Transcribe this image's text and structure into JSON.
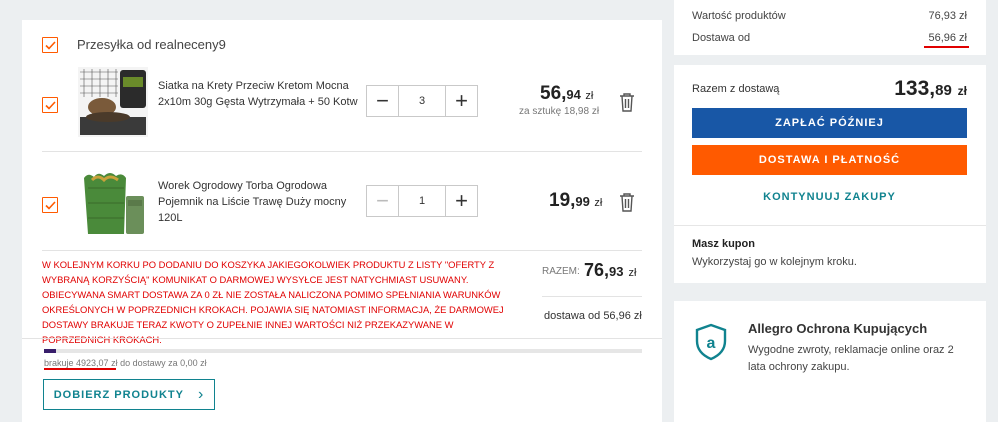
{
  "seller": {
    "label": "Przesyłka od realneceny9"
  },
  "items": [
    {
      "name": "Siatka na Krety Przeciw Kretom Mocna 2x10m 30g Gęsta Wytrzymała + 50 Kotw",
      "quantity": "3",
      "price_main": "56,",
      "price_dec": "94",
      "currency": "zł",
      "unit_price": "za sztukę 18,98 zł"
    },
    {
      "name": "Worek Ogrodowy Torba Ogrodowa Pojemnik na Liście Trawę Duży mocny 120L",
      "quantity": "1",
      "price_main": "19,",
      "price_dec": "99",
      "currency": "zł"
    }
  ],
  "note": "W kolejnym korku po dodaniu do koszyka jakiegokolwiek produktu z listy \"oferty z wybraną korzyścią\" komunikat o darmowej wysyłce jest natychmiast usuwany. Obiecywana Smart dostawa za 0 zł nie została naliczona pomimo spełniania warunków określonych w poprzednich krokach. Pojawia się natomiast informacja, że darmowej dostawy brakuje teraz kwoty o zupełnie innej wartości niż przekazywane w poprzednich krokach.",
  "summary": {
    "label": "RAZEM:",
    "main": "76,",
    "dec": "93",
    "currency": "zł",
    "delivery_from": "dostawa od 56,96 zł"
  },
  "free_delivery": {
    "progress": 0.02,
    "prefix": "brakuje ",
    "amount": "4923,07",
    "suffix": " zł do dostawy za 0,00 zł"
  },
  "pick_button": {
    "label": "DOBIERZ PRODUKTY",
    "arrow": "›"
  },
  "order": {
    "products_label": "Wartość produktów",
    "products_value": "76,93 zł",
    "delivery_label": "Dostawa od",
    "delivery_value": "56,96 zł",
    "total_label": "Razem z dostawą",
    "total_main": "133,",
    "total_dec": "89",
    "total_currency": "zł",
    "pay_later": "ZAPŁAĆ PÓŹNIEJ",
    "delivery_payment": "DOSTAWA I PŁATNOŚĆ",
    "continue": "KONTYNUUJ ZAKUPY",
    "coupon_title": "Masz kupon",
    "coupon_sub": "Wykorzystaj go w kolejnym kroku."
  },
  "protection": {
    "title": "Allegro Ochrona Kupujących",
    "text": "Wygodne zwroty, reklamacje online oraz 2 lata ochrony zakupu."
  },
  "colors": {
    "orange": "#ff5a00",
    "blue": "#1857a6",
    "teal": "#10838f",
    "red": "#e00000"
  }
}
